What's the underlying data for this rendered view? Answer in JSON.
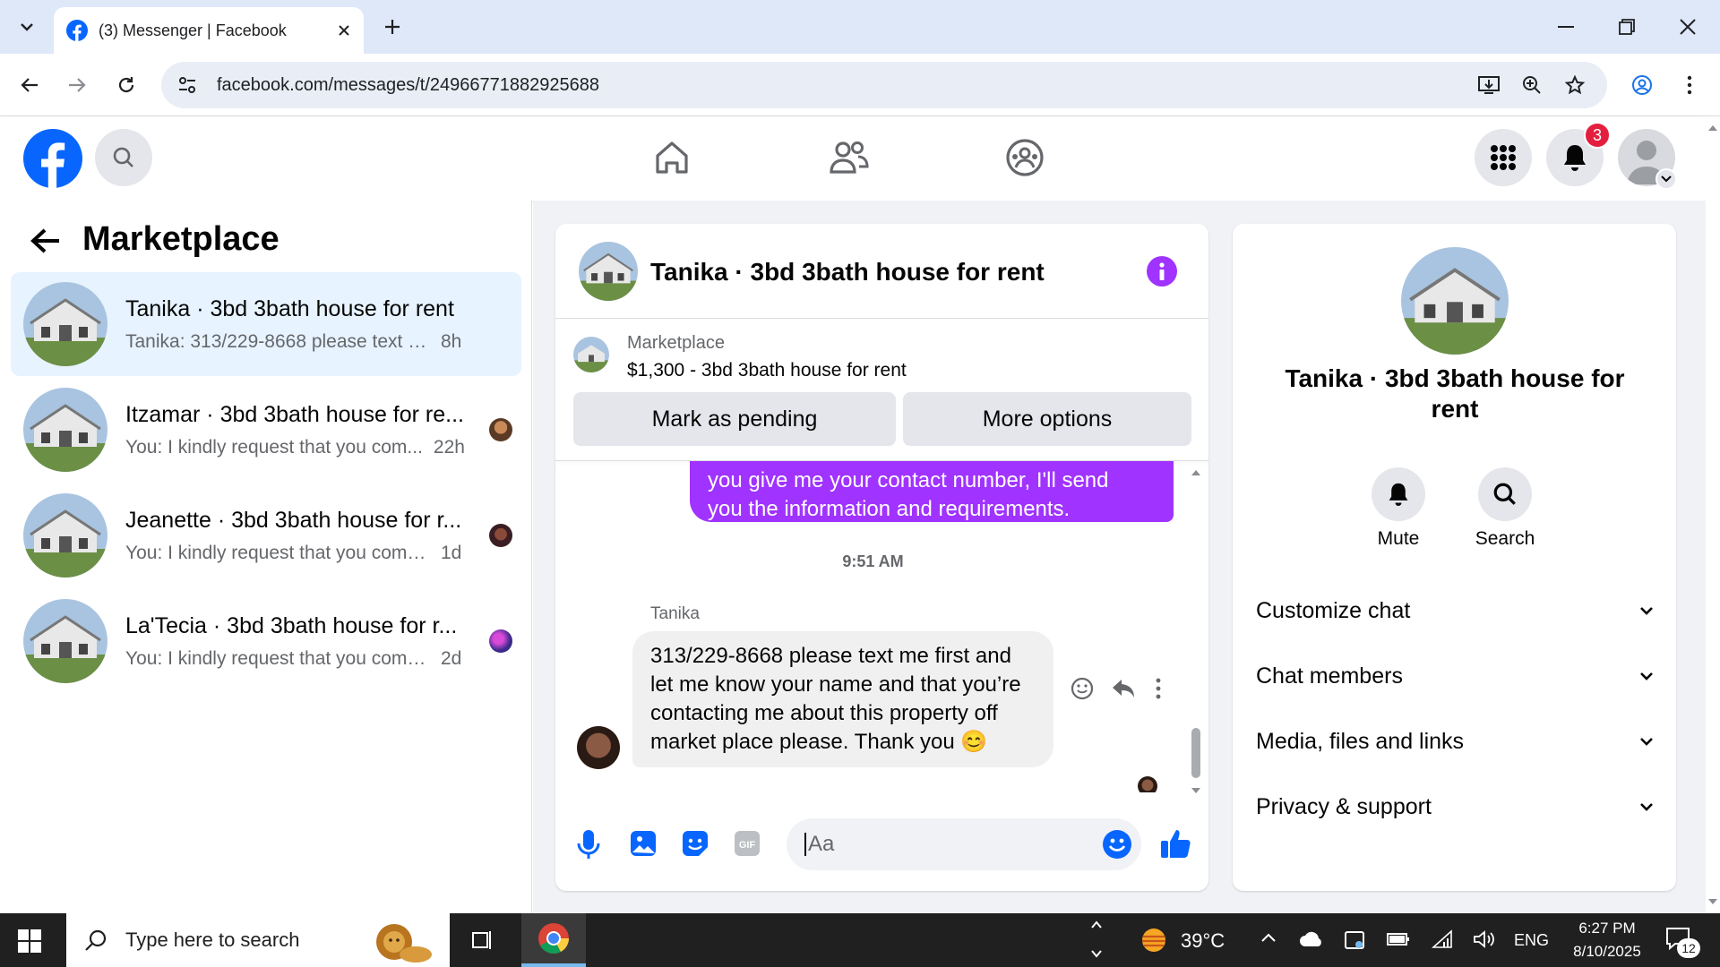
{
  "browser": {
    "tab_title": "(3) Messenger | Facebook",
    "url": "facebook.com/messages/t/24966771882925688"
  },
  "header": {
    "notification_count": "3"
  },
  "left_panel": {
    "title": "Marketplace",
    "conversations": [
      {
        "name": "Tanika · 3bd 3bath house for rent",
        "preview": "Tanika: 313/229-8668 please text me f...",
        "time": "8h"
      },
      {
        "name": "Itzamar · 3bd 3bath house for re...",
        "preview": "You: I kindly request that you com...",
        "time": "22h"
      },
      {
        "name": "Jeanette · 3bd 3bath house for r...",
        "preview": "You: I kindly request that you comp...",
        "time": "1d"
      },
      {
        "name": "La'Tecia · 3bd 3bath house for r...",
        "preview": "You: I kindly request that you comp...",
        "time": "2d"
      }
    ]
  },
  "chat": {
    "title": "Tanika · 3bd 3bath house for rent",
    "listing_source": "Marketplace",
    "listing_title": "$1,300 - 3bd 3bath house for rent",
    "mark_pending_label": "Mark as pending",
    "more_options_label": "More options",
    "outgoing_line1": "you give me your contact number, I'll send",
    "outgoing_line2": "you the information and requirements.",
    "timestamp": "9:51 AM",
    "sender": "Tanika",
    "incoming_message": "313/229-8668 please text me first and let me know your name and that you’re contacting me about this property off market place please. Thank you 😊",
    "input_placeholder": "Aa"
  },
  "info_panel": {
    "name": "Tanika · 3bd 3bath house for rent",
    "mute_label": "Mute",
    "search_label": "Search",
    "sections": [
      "Customize chat",
      "Chat members",
      "Media, files and links",
      "Privacy & support"
    ]
  },
  "taskbar": {
    "search_placeholder": "Type here to search",
    "weather": "39°C",
    "language": "ENG",
    "time": "6:27 PM",
    "date": "8/10/2025",
    "notification_badge": "12"
  },
  "colors": {
    "facebook_blue": "#0866ff",
    "messenger_purple": "#a033ff",
    "notification_red": "#e41e3f"
  }
}
